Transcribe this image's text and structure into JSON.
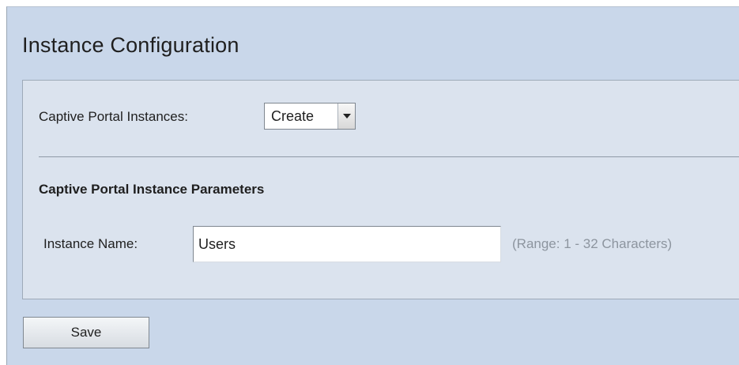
{
  "header": {
    "title": "Instance Configuration"
  },
  "instances": {
    "label": "Captive Portal Instances:",
    "selected": "Create"
  },
  "parameters": {
    "section_title": "Captive Portal Instance Parameters",
    "instance_name_label": "Instance Name:",
    "instance_name_value": "Users",
    "instance_name_hint": "(Range: 1 - 32 Characters)"
  },
  "actions": {
    "save_label": "Save"
  },
  "icons": {
    "dropdown": "chevron-down-icon"
  },
  "colors": {
    "page_background": "#c9d7ea",
    "panel_background": "#dbe3ee",
    "hint_text": "#8d959f"
  }
}
